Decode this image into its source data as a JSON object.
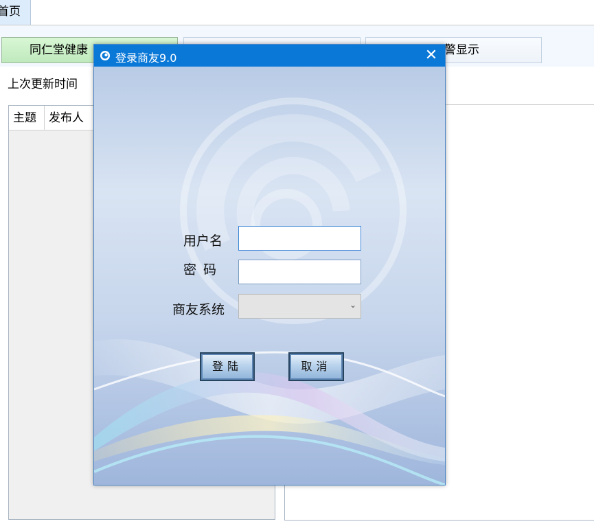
{
  "app": {
    "home_tab": "首页",
    "buttons": {
      "green": "同仁堂健康",
      "middle": "",
      "right": "警显示"
    },
    "update_label": "上次更新时间",
    "table_headers": [
      "主题",
      "发布人"
    ]
  },
  "dialog": {
    "title": "登录商友9.0",
    "close_glyph": "✕",
    "labels": {
      "username": "用户名",
      "password": "密码",
      "system": "商友系统"
    },
    "fields": {
      "username_value": "",
      "password_value": "",
      "system_selected": ""
    },
    "buttons": {
      "login": "登陆",
      "cancel": "取消"
    },
    "colors": {
      "titlebar": "#0a78d7",
      "button_border": "#27445f"
    }
  }
}
